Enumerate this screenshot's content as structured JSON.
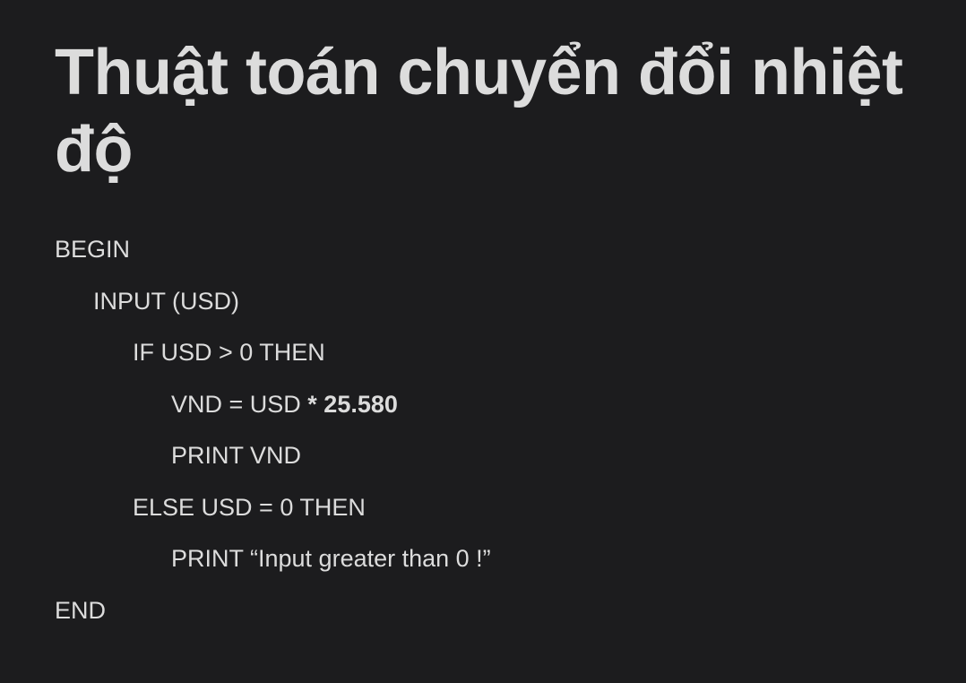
{
  "title": "Thuật toán chuyển đổi nhiệt độ",
  "code": {
    "begin": "BEGIN",
    "input": "INPUT (USD)",
    "if": "IF USD > 0 THEN",
    "assign_prefix": "VND = USD ",
    "assign_bold": "* 25.580",
    "print_vnd": "PRINT VND",
    "else": "ELSE USD = 0 THEN",
    "print_msg": "PRINT “Input greater than 0 !”",
    "end": "END"
  }
}
